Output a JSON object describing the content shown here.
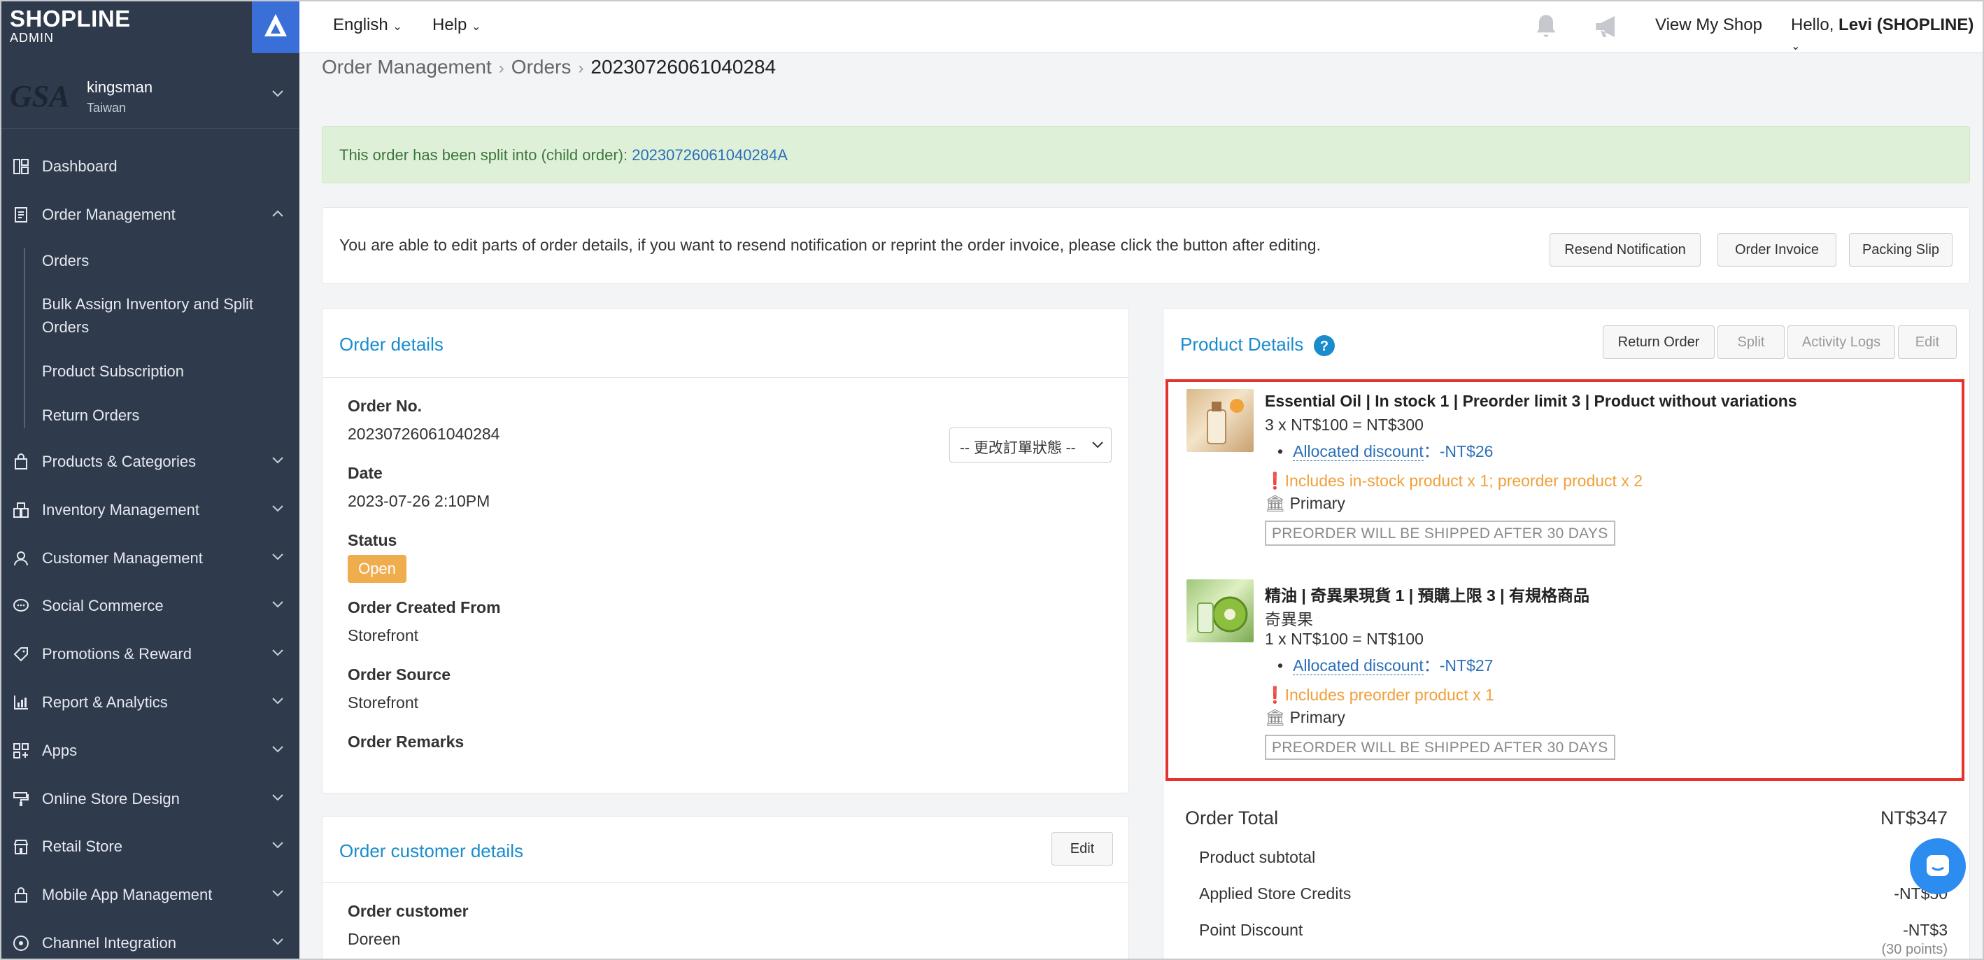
{
  "brand": {
    "name": "SHOPLINE",
    "sub": "ADMIN"
  },
  "shop": {
    "name": "kingsman",
    "region": "Taiwan",
    "avatar_text": "GSA"
  },
  "sidebar": {
    "items": [
      {
        "label": "Dashboard",
        "icon": "dashboard-icon"
      },
      {
        "label": "Order Management",
        "icon": "order-icon"
      },
      {
        "label": "Products & Categories",
        "icon": "bag-icon"
      },
      {
        "label": "Inventory Management",
        "icon": "inventory-icon"
      },
      {
        "label": "Customer Management",
        "icon": "user-icon"
      },
      {
        "label": "Social Commerce",
        "icon": "chat-icon"
      },
      {
        "label": "Promotions & Reward",
        "icon": "tag-icon"
      },
      {
        "label": "Report & Analytics",
        "icon": "chart-icon"
      },
      {
        "label": "Apps",
        "icon": "apps-icon"
      },
      {
        "label": "Online Store Design",
        "icon": "paint-icon"
      },
      {
        "label": "Retail Store",
        "icon": "store-icon"
      },
      {
        "label": "Mobile App Management",
        "icon": "lock-icon"
      },
      {
        "label": "Channel Integration",
        "icon": "channel-icon"
      }
    ],
    "sub_items": [
      "Orders",
      "Bulk Assign Inventory and Split Orders",
      "Product Subscription",
      "Return Orders"
    ]
  },
  "topbar": {
    "language": "English",
    "help": "Help",
    "view_shop": "View My Shop",
    "greeting": "Hello, ",
    "user": "Levi (SHOPLINE)"
  },
  "breadcrumb": {
    "root": "Order Management",
    "mid": "Orders",
    "current": "20230726061040284"
  },
  "alert": {
    "text": "This order has been split into (child order): ",
    "link": "20230726061040284A"
  },
  "info": {
    "text": "You are able to edit parts of order details, if you want to resend notification or reprint the order invoice, please click the button after editing.",
    "buttons": [
      "Resend Notification",
      "Order Invoice",
      "Packing Slip"
    ]
  },
  "order_details": {
    "title": "Order details",
    "status_select": "-- 更改訂單狀態 --",
    "order_no_label": "Order No.",
    "order_no": "20230726061040284",
    "date_label": "Date",
    "date": "2023-07-26 2:10PM",
    "status_label": "Status",
    "status": "Open",
    "created_from_label": "Order Created From",
    "created_from": "Storefront",
    "source_label": "Order Source",
    "source": "Storefront",
    "remarks_label": "Order Remarks"
  },
  "customer_details": {
    "title": "Order customer details",
    "edit": "Edit",
    "customer_label": "Order customer",
    "customer": "Doreen"
  },
  "product_details": {
    "title": "Product Details",
    "buttons": [
      "Return Order",
      "Split",
      "Activity Logs",
      "Edit"
    ],
    "products": [
      {
        "name": "Essential Oil | In stock 1 | Preorder limit 3 | Product without variations",
        "variation": "",
        "qty_line": "3 x NT$100 = NT$300",
        "discount_label": "Allocated discount",
        "discount_value": "：-NT$26",
        "warning": "Includes in-stock product x 1; preorder product x 2",
        "warehouse": "Primary",
        "tag": "PREORDER WILL BE SHIPPED AFTER 30 DAYS"
      },
      {
        "name": "精油 | 奇異果現貨 1 | 預購上限 3 | 有規格商品",
        "variation": "奇異果",
        "qty_line": "1 x NT$100 = NT$100",
        "discount_label": "Allocated discount",
        "discount_value": "：-NT$27",
        "warning": "Includes preorder product x 1",
        "warehouse": "Primary",
        "tag": "PREORDER WILL BE SHIPPED AFTER 30 DAYS"
      }
    ]
  },
  "summary": {
    "total_label": "Order Total",
    "total": "NT$347",
    "subtotal_label": "Product subtotal",
    "subtotal": "NT",
    "credits_label": "Applied Store Credits",
    "credits": "-NT$50",
    "points_label": "Point Discount",
    "points": "-NT$3",
    "points_note": "(30 points)"
  },
  "colors": {
    "sidebar": "#2f3a4c",
    "accent": "#1a8ccd",
    "status": "#f0ad4e",
    "highlight": "#e5322d"
  }
}
